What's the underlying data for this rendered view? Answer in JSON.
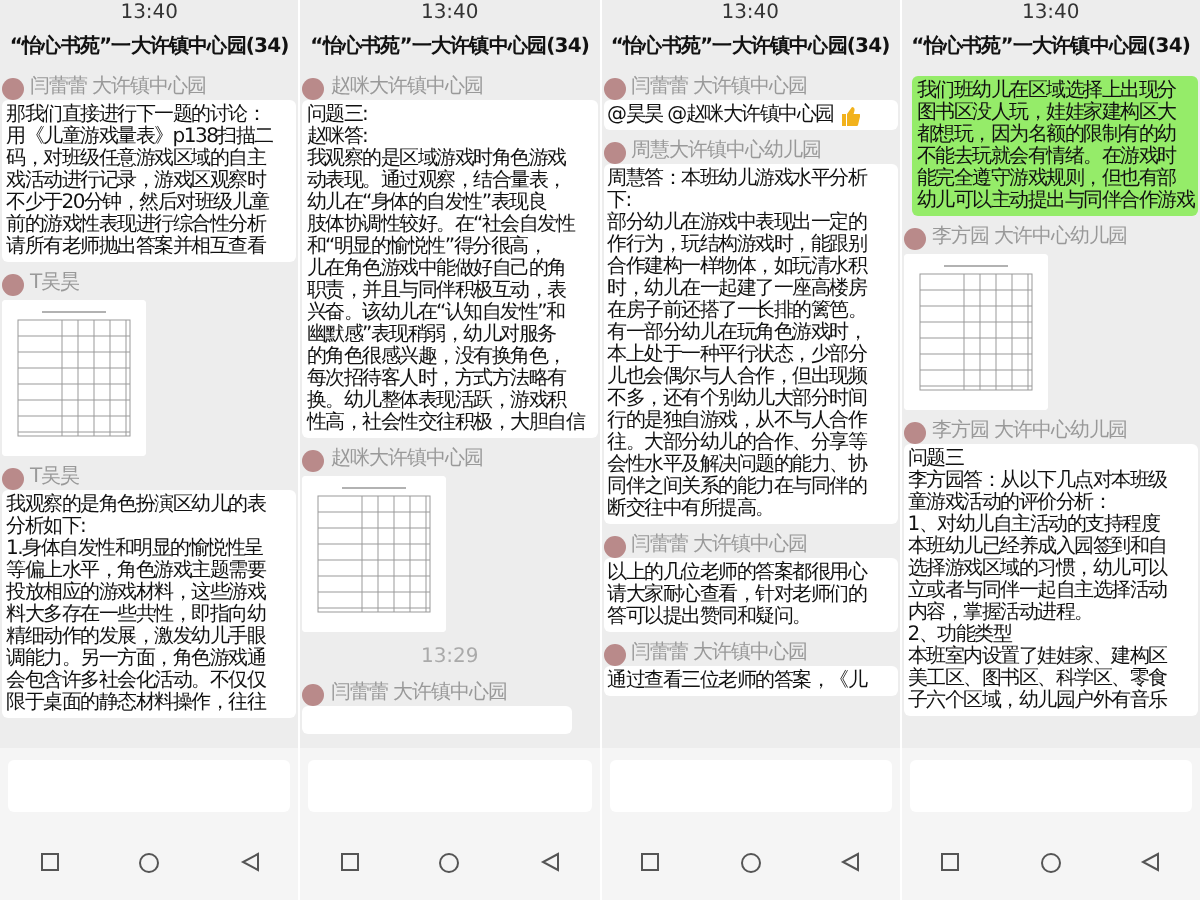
{
  "panels": [
    {
      "time": "13:40",
      "title": "“怡心书苑”一大许镇中心园(34)",
      "items": [
        {
          "kind": "text",
          "outgoing": false,
          "sender": "闫蕾蕾 大许镇中心园",
          "lines": [
            "那我们直接进行下一题的讨论：",
            "用《儿童游戏量表》p138扫描二",
            "码，对班级任意游戏区域的自主",
            "戏活动进行记录，游戏区观察时",
            "不少于20分钟，然后对班级儿童",
            "前的游戏性表现进行综合性分析",
            "请所有老师抛出答案并相互查看"
          ]
        },
        {
          "kind": "image",
          "sender": "T吴昊"
        },
        {
          "kind": "text",
          "outgoing": false,
          "sender": "T吴昊",
          "lines": [
            "我观察的是角色扮演区幼儿的表",
            "分析如下:",
            "1.身体自发性和明显的愉悦性呈",
            "等偏上水平，角色游戏主题需要",
            "投放相应的游戏材料，这些游戏",
            "料大多存在一些共性，即指向幼",
            "精细动作的发展，激发幼儿手眼",
            "调能力。另一方面，角色游戏通",
            "会包含许多社会化活动。不仅仅",
            "限于桌面的静态材料操作，往往"
          ]
        }
      ]
    },
    {
      "time": "13:40",
      "title": "“怡心书苑”一大许镇中心园(34)",
      "items": [
        {
          "kind": "text",
          "outgoing": false,
          "sender": "赵咪大许镇中心园",
          "lines": [
            "问题三:",
            "赵咪答:",
            "我观察的是区域游戏时角色游戏",
            "动表现。通过观察，结合量表，",
            "幼儿在“身体的自发性”表现良",
            "肢体协调性较好。在“社会自发性",
            "和“明显的愉悦性”得分很高，",
            "儿在角色游戏中能做好自己的角",
            "职责，并且与同伴积极互动，表",
            "兴奋。该幼儿在“认知自发性”和",
            "幽默感”表现稍弱，幼儿对服务",
            "的角色很感兴趣，没有换角色，",
            "每次招待客人时，方式方法略有",
            "换。幼儿整体表现活跃，游戏积",
            "性高，社会性交往积极，大胆自信"
          ]
        },
        {
          "kind": "image",
          "sender": "赵咪大许镇中心园"
        },
        {
          "kind": "timestamp",
          "text": "13:29"
        },
        {
          "kind": "text",
          "outgoing": false,
          "sender": "闫蕾蕾 大许镇中心园"
        }
      ]
    },
    {
      "time": "13:40",
      "title": "“怡心书苑”一大许镇中心园(34)",
      "items": [
        {
          "kind": "text",
          "outgoing": false,
          "sender": "闫蕾蕾 大许镇中心园",
          "lines": [
            "@昊昊 @赵咪大许镇中心园"
          ],
          "thumbs_up": true
        },
        {
          "kind": "text",
          "outgoing": false,
          "sender": "周慧大许镇中心幼儿园",
          "lines": [
            "周慧答：本班幼儿游戏水平分析",
            "下:",
            "部分幼儿在游戏中表现出一定的",
            "作行为，玩结构游戏时，能跟别",
            "合作建构一样物体，如玩清水积",
            "时，幼儿在一起建了一座高楼房",
            "在房子前还搭了一长排的篱笆。",
            "有一部分幼儿在玩角色游戏时，",
            "本上处于一种平行状态，少部分",
            "儿也会偶尔与人合作，但出现频",
            "不多，还有个别幼儿大部分时间",
            "行的是独自游戏，从不与人合作",
            "往。大部分幼儿的合作、分享等",
            "会性水平及解决问题的能力、协",
            "同伴之间关系的能力在与同伴的",
            "断交往中有所提高。"
          ]
        },
        {
          "kind": "text",
          "outgoing": false,
          "sender": "闫蕾蕾 大许镇中心园",
          "lines": [
            "以上的几位老师的答案都很用心",
            "请大家耐心查看，针对老师们的",
            "答可以提出赞同和疑问。"
          ]
        },
        {
          "kind": "text",
          "outgoing": false,
          "sender": "闫蕾蕾 大许镇中心园",
          "lines": [
            "通过查看三位老师的答案，《儿"
          ]
        }
      ]
    },
    {
      "time": "13:40",
      "title": "“怡心书苑”一大许镇中心园(34)",
      "items": [
        {
          "kind": "text",
          "outgoing": true,
          "lines": [
            "我们班幼儿在区域选择上出现分",
            "图书区没人玩，娃娃家建构区大",
            "都想玩，因为名额的限制有的幼",
            "不能去玩就会有情绪。在游戏时",
            "能完全遵守游戏规则，但也有部",
            "幼儿可以主动提出与同伴合作游戏"
          ]
        },
        {
          "kind": "image",
          "sender": "李方园 大许中心幼儿园"
        },
        {
          "kind": "text",
          "outgoing": false,
          "sender": "李方园 大许中心幼儿园",
          "lines": [
            "问题三",
            "李方园答：从以下几点对本班级",
            "童游戏活动的评价分析：",
            "1、对幼儿自主活动的支持程度",
            "本班幼儿已经养成入园签到和自",
            "选择游戏区域的习惯，幼儿可以",
            "立或者与同伴一起自主选择活动",
            "内容，掌握活动进程。",
            "2、功能类型",
            "本班室内设置了娃娃家、建构区",
            "美工区、图书区、科学区、零食",
            "子六个区域，幼儿园户外有音乐"
          ]
        }
      ]
    }
  ]
}
